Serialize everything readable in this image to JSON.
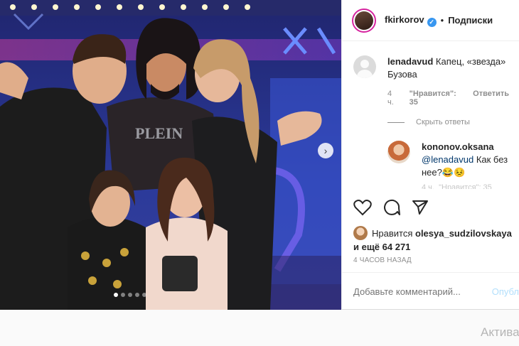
{
  "post": {
    "author": "fkirkorov",
    "follow_label": "Подписки",
    "icons": {
      "next": "chevron-right-icon",
      "verified": "verified-badge-icon",
      "like": "heart-icon",
      "comment": "speech-bubble-icon",
      "share": "paper-plane-icon"
    }
  },
  "comments": [
    {
      "user": "lenadavud",
      "text": "Капец, «звезда» Бузова",
      "age": "4 ч.",
      "likes_label": "\"Нравится\": 35",
      "reply_label": "Ответить"
    }
  ],
  "hide_replies_label": "Скрыть ответы",
  "reply": {
    "user": "kononov.oksana",
    "mention": "@lenadavud",
    "text": " Как без нее?😂😣"
  },
  "likes": {
    "prefix": "Нравится",
    "user": "olesya_sudzilovskaya",
    "suffix": " и ещё 64 271"
  },
  "timestamp": "4 ЧАСОВ НАЗАД",
  "comment_input": {
    "placeholder": "Добавьте комментарий...",
    "publish_label": "Опубл"
  },
  "watermark": "Актива",
  "colors": {
    "accent": "#3897f0",
    "link": "#00376b",
    "muted": "#8e8e8e",
    "stage": "#1b1e5e"
  }
}
